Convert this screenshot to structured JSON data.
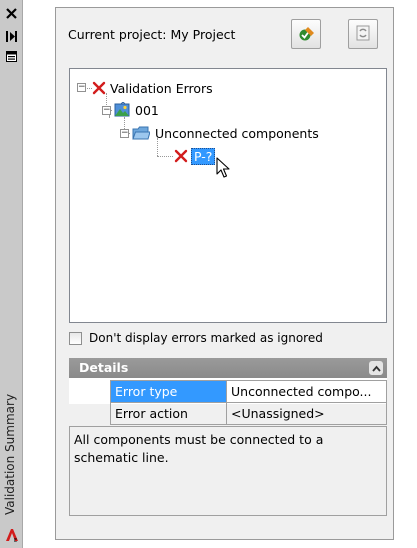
{
  "sidebar": {
    "title": "Validation Summary",
    "tools": [
      "close-icon",
      "auto-hide-icon",
      "properties-icon"
    ],
    "app_icon": "autocad-electrical-icon"
  },
  "header": {
    "project_label": "Current project: My Project",
    "buttons": [
      "validate-project-icon",
      "refresh-icon"
    ]
  },
  "tree": {
    "root": {
      "label": "Validation Errors",
      "icon": "red-x-icon"
    },
    "drawing": {
      "label": "001",
      "icon": "drawing-icon"
    },
    "folder": {
      "label": "Unconnected components",
      "icon": "folder-icon"
    },
    "item": {
      "label": "P-?",
      "icon": "red-x-icon",
      "selected": true
    }
  },
  "options": {
    "ignore_label": "Don't display errors marked as ignored",
    "ignore_checked": false
  },
  "details": {
    "title": "Details",
    "rows": [
      {
        "name": "Error type",
        "value": "Unconnected compo..."
      },
      {
        "name": "Error action",
        "value": "<Unassigned>"
      }
    ],
    "description": "All components must be connected to a schematic line."
  },
  "colors": {
    "selection": "#3399ff",
    "panel": "#f0f0f0",
    "error": "#d21c1c"
  }
}
